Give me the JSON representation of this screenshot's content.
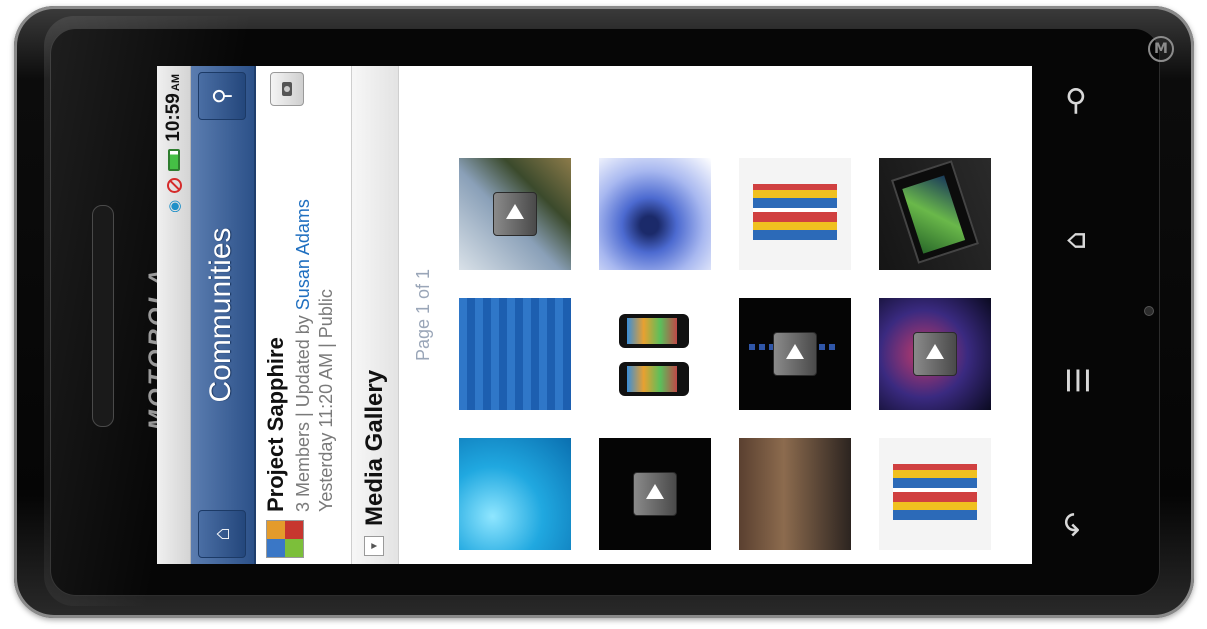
{
  "device": {
    "brand": "MOTOROLA",
    "logo": "M"
  },
  "status_bar": {
    "time": "10:59",
    "ampm": "AM",
    "icons": [
      "wifi-icon",
      "blocked-icon",
      "battery-icon"
    ]
  },
  "title_bar": {
    "title": "Communities",
    "left_icon": "home-icon",
    "right_icon": "search-icon"
  },
  "community": {
    "name": "Project Sapphire",
    "members": "3 Members",
    "separator": " | ",
    "updated_prefix": "Updated by ",
    "updated_by": "Susan Adams",
    "updated_time": "Yesterday 11:20 AM",
    "visibility": "Public"
  },
  "section": {
    "title": "Media Gallery"
  },
  "pager": {
    "text": "Page 1 of 1"
  },
  "gallery": {
    "items": [
      {
        "name": "water",
        "video": false
      },
      {
        "name": "ibm-logo",
        "video": false
      },
      {
        "name": "railway",
        "video": true
      },
      {
        "name": "dark-video",
        "video": true
      },
      {
        "name": "iphones",
        "video": false
      },
      {
        "name": "eye",
        "video": false
      },
      {
        "name": "crowd",
        "video": false
      },
      {
        "name": "dark-video-text",
        "video": true
      },
      {
        "name": "collage",
        "video": false
      },
      {
        "name": "collage-2",
        "video": false
      },
      {
        "name": "concert",
        "video": true
      },
      {
        "name": "tablet",
        "video": false
      }
    ]
  },
  "hardware_buttons": [
    "search-icon",
    "home-icon",
    "menu-icon",
    "back-icon"
  ],
  "colors": {
    "title_bar": "#2c5189",
    "link": "#1f6fc0",
    "pager": "#9aa6b8"
  }
}
